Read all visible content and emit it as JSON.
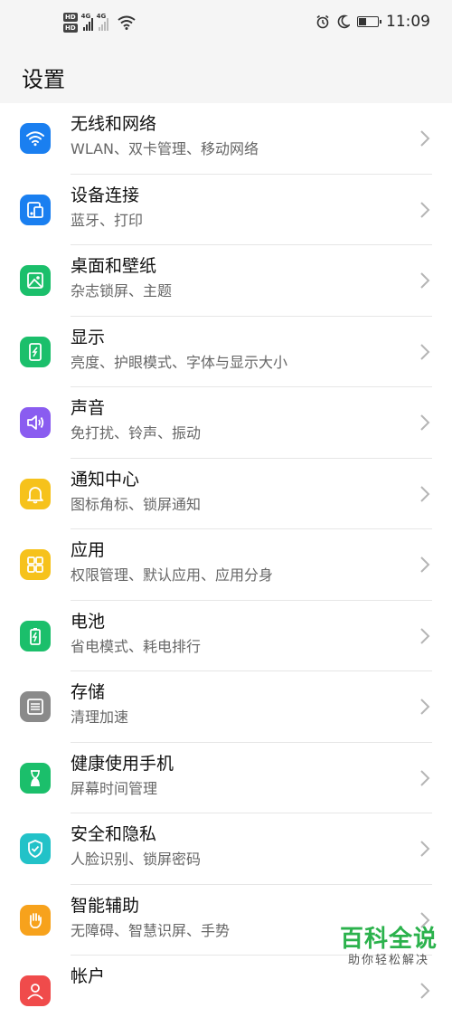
{
  "status_bar": {
    "hd_badges": [
      "HD",
      "HD"
    ],
    "network_labels": [
      "4G",
      "4G"
    ],
    "time": "11:09"
  },
  "header": {
    "title": "设置"
  },
  "settings_items": [
    {
      "title": "无线和网络",
      "subtitle": "WLAN、双卡管理、移动网络",
      "icon": "wifi-icon",
      "color": "#1a7ff0"
    },
    {
      "title": "设备连接",
      "subtitle": "蓝牙、打印",
      "icon": "device-connection-icon",
      "color": "#1a7ff0"
    },
    {
      "title": "桌面和壁纸",
      "subtitle": "杂志锁屏、主题",
      "icon": "wallpaper-icon",
      "color": "#1bbf6b"
    },
    {
      "title": "显示",
      "subtitle": "亮度、护眼模式、字体与显示大小",
      "icon": "display-icon",
      "color": "#1bbf6b"
    },
    {
      "title": "声音",
      "subtitle": "免打扰、铃声、振动",
      "icon": "speaker-icon",
      "color": "#8a5cf0"
    },
    {
      "title": "通知中心",
      "subtitle": "图标角标、锁屏通知",
      "icon": "bell-icon",
      "color": "#f6c21c"
    },
    {
      "title": "应用",
      "subtitle": "权限管理、默认应用、应用分身",
      "icon": "apps-grid-icon",
      "color": "#f6c21c"
    },
    {
      "title": "电池",
      "subtitle": "省电模式、耗电排行",
      "icon": "battery-icon",
      "color": "#1bbf6b"
    },
    {
      "title": "存储",
      "subtitle": "清理加速",
      "icon": "storage-icon",
      "color": "#8a8a8a"
    },
    {
      "title": "健康使用手机",
      "subtitle": "屏幕时间管理",
      "icon": "hourglass-icon",
      "color": "#1bbf6b"
    },
    {
      "title": "安全和隐私",
      "subtitle": "人脸识别、锁屏密码",
      "icon": "shield-icon",
      "color": "#22c2c8"
    },
    {
      "title": "智能辅助",
      "subtitle": "无障碍、智慧识屏、手势",
      "icon": "hand-icon",
      "color": "#f7a21c"
    },
    {
      "title": "帐户",
      "subtitle": "",
      "icon": "account-icon",
      "color": "#f04b4b"
    }
  ],
  "watermark": {
    "main": "百科全说",
    "sub": "助你轻松解决"
  }
}
